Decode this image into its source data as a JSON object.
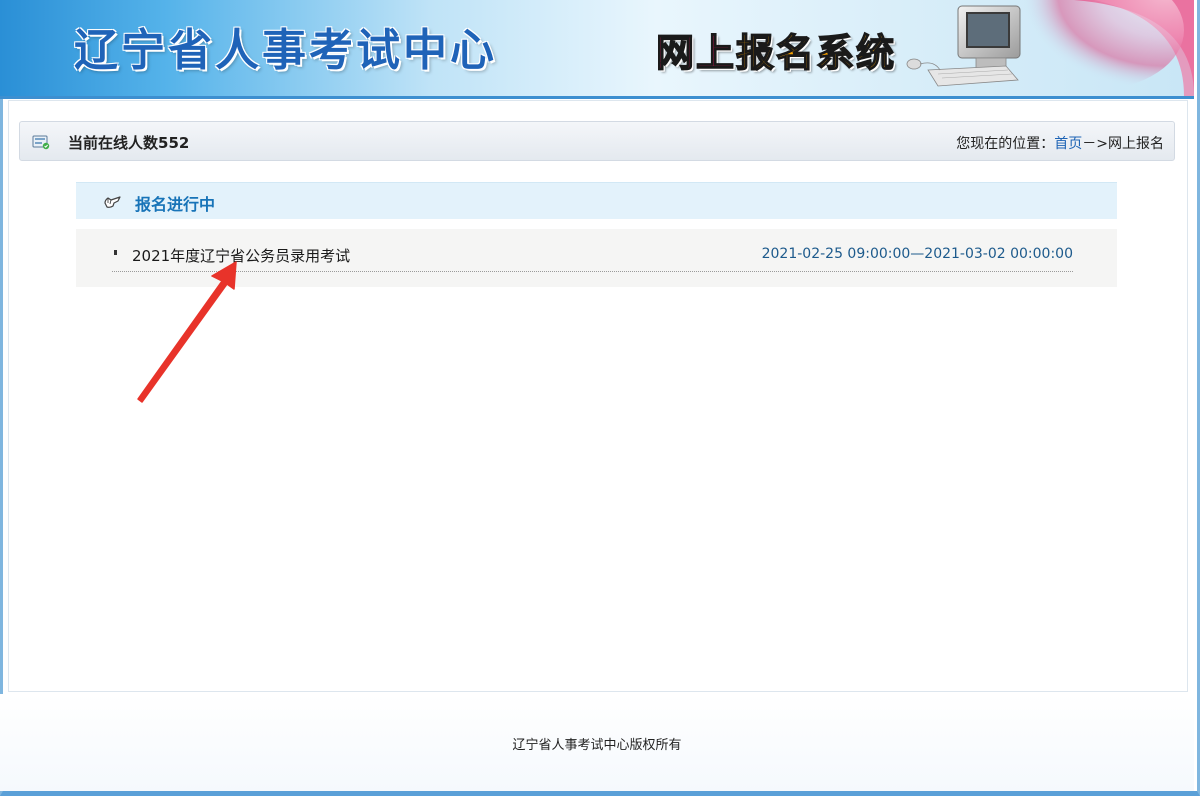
{
  "header": {
    "title": "辽宁省人事考试中心",
    "subtitle_chars": [
      "网",
      "上",
      "报",
      "名",
      "系",
      "统"
    ],
    "subtitle_colors": [
      "#e8175d",
      "#e8175d",
      "#f5a000",
      "#f5a000",
      "#f5a000",
      "#f5a000"
    ],
    "title_color": "#1f63b8"
  },
  "infobar": {
    "online_text": "当前在线人数552",
    "breadcrumb_prefix": "您现在的位置：",
    "breadcrumb_home": "首页",
    "breadcrumb_separator": "－",
    "breadcrumb_current": ">网上报名"
  },
  "section": {
    "title": "报名进行中"
  },
  "exams": [
    {
      "name": "2021年度辽宁省公务员录用考试",
      "period": "2021-02-25 09:00:00—2021-03-02 00:00:00"
    }
  ],
  "footer": {
    "text": "辽宁省人事考试中心版权所有"
  },
  "colors": {
    "accent": "#1874b8",
    "link": "#1d63b5",
    "annotation_arrow": "#e8332a"
  }
}
